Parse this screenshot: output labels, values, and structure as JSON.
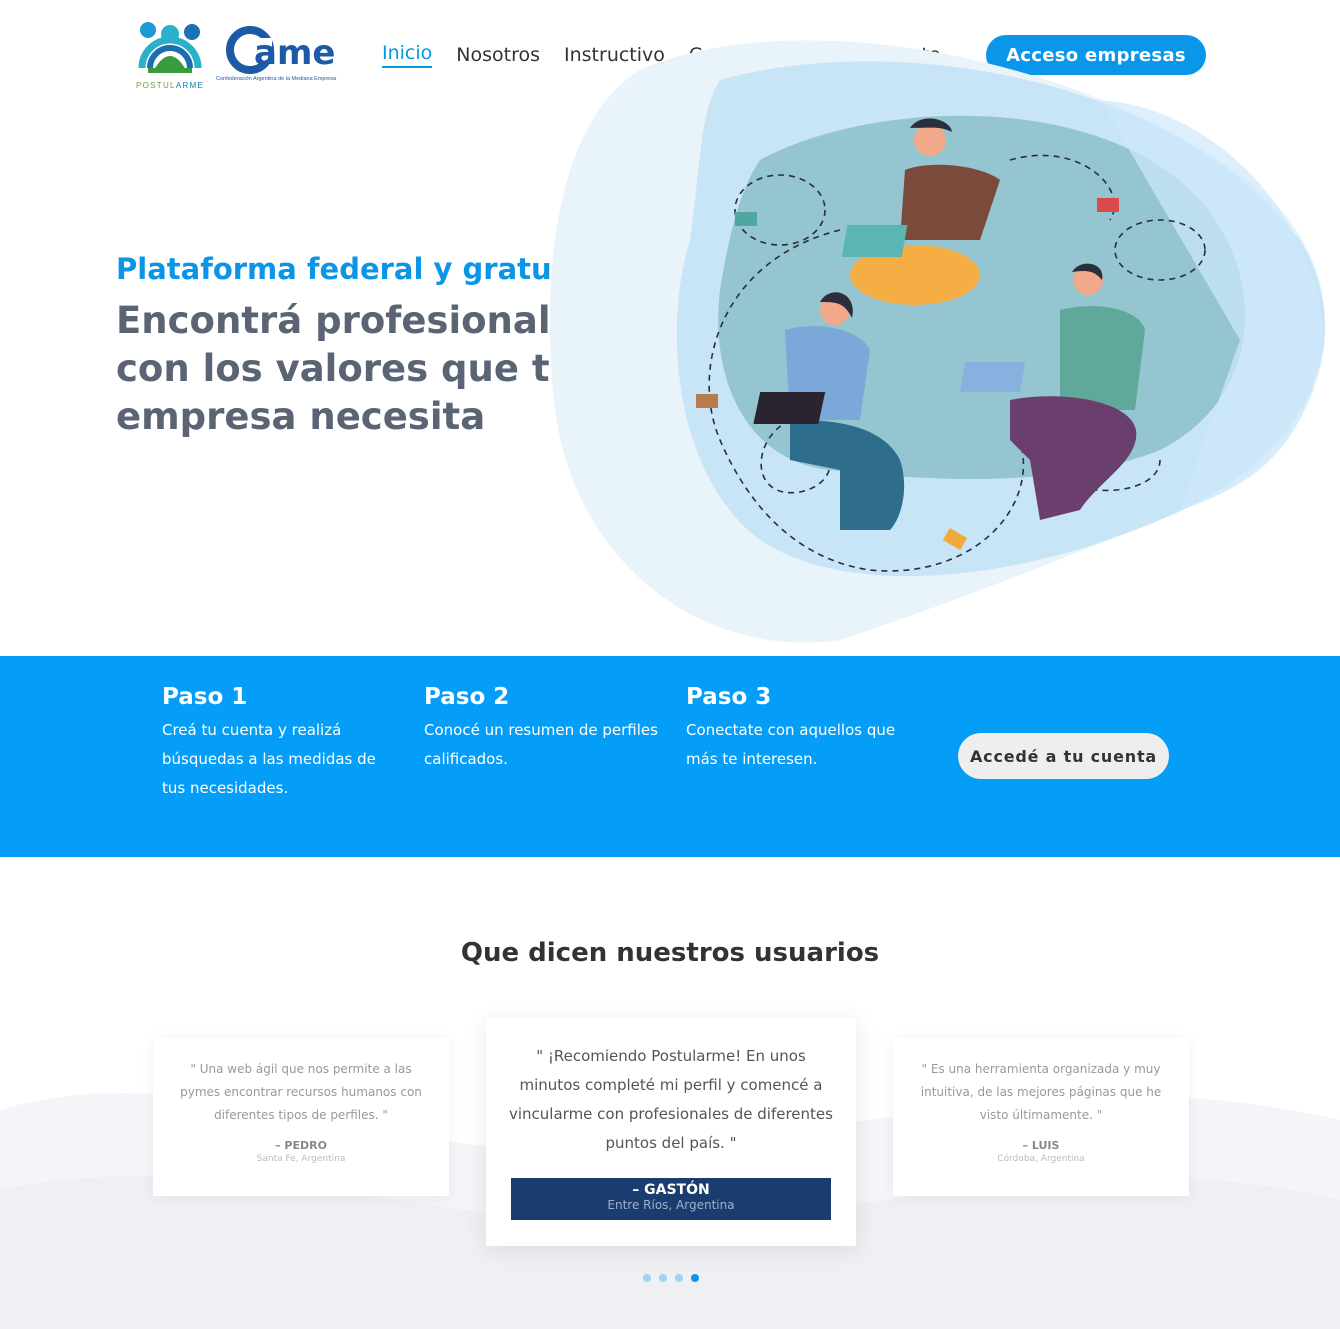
{
  "header": {
    "logo_postularme": {
      "prefix": "POSTUL",
      "accent": "ARME"
    },
    "logo_came": {
      "word": "ame",
      "subtitle": "Confederación Argentina de la Mediana Empresa"
    },
    "nav": [
      {
        "label": "Inicio",
        "active": true
      },
      {
        "label": "Nosotros",
        "active": false
      },
      {
        "label": "Instructivo",
        "active": false
      },
      {
        "label": "Contacto",
        "active": false
      },
      {
        "label": "Soy postulante",
        "active": false
      }
    ],
    "cta_label": "Acceso empresas"
  },
  "hero": {
    "subtitle": "Plataforma federal y gratuita",
    "title": "Encontrá profesionales con los valores que tu empresa necesita"
  },
  "steps": [
    {
      "title": "Paso 1",
      "text": "Creá tu cuenta y realizá búsquedas a las medidas de tus necesidades."
    },
    {
      "title": "Paso 2",
      "text": "Conocé un resumen de perfiles calificados."
    },
    {
      "title": "Paso 3",
      "text": "Conectate con aquellos que más te interesen."
    }
  ],
  "steps_cta_label": "Accedé a tu cuenta",
  "testimonials": {
    "title": "Que dicen nuestros usuarios",
    "items": [
      {
        "quote": "\" Una web ágil que nos permite a las pymes encontrar recursos humanos con diferentes tipos de perfiles. \"",
        "name": "– PEDRO",
        "location": "Santa Fe, Argentina"
      },
      {
        "quote": "\" ¡Recomiendo Postularme! En unos minutos completé mi perfil y comencé a vincularme con profesionales de diferentes puntos del país. \"",
        "name": "– GASTÓN",
        "location": "Entre Ríos, Argentina"
      },
      {
        "quote": "\" Es una herramienta organizada y muy intuitiva, de las mejores páginas que he visto últimamente. \"",
        "name": "– LUIS",
        "location": "Córdoba, Argentina"
      }
    ],
    "pagination": {
      "total": 4,
      "active_index": 3
    }
  },
  "colors": {
    "brand_blue": "#0a97ea",
    "band_blue": "#049ef8",
    "title_gray": "#5a6474",
    "author_navy": "#1b3c6f"
  }
}
